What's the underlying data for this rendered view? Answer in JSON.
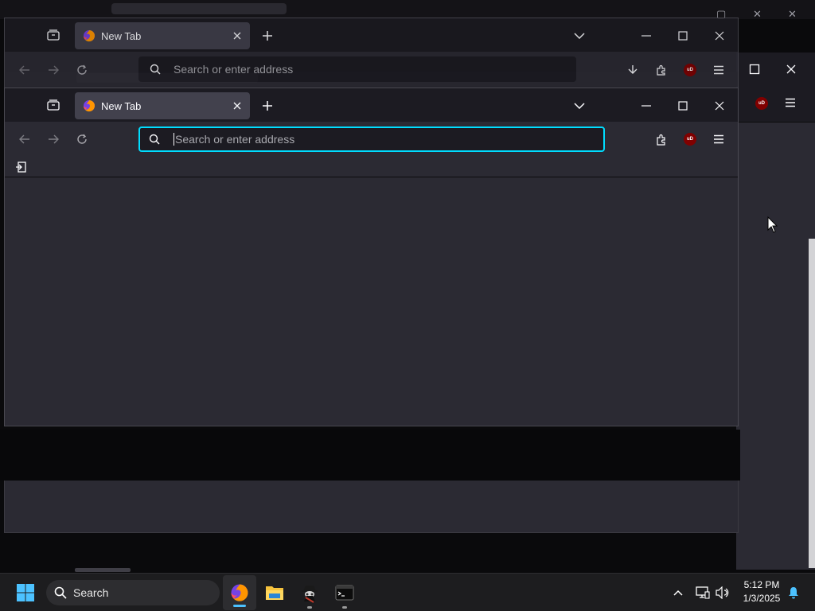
{
  "colors": {
    "accent_focus": "#00ddff",
    "chrome_dark": "#1c1b22",
    "content_bg": "#2b2a33",
    "tab_active": "#42414d",
    "ublock_red": "#800000",
    "taskbar": "#1d1d1f"
  },
  "background_window": {
    "tab": {
      "title": "New Tab",
      "icon": "firefox-icon"
    },
    "url_placeholder": "Search or enter address"
  },
  "front_window": {
    "tab": {
      "title": "New Tab",
      "icon": "firefox-icon",
      "close_icon": "close-icon"
    },
    "tabbar_buttons": [
      "firefox-view-icon",
      "new-tab-icon",
      "list-all-tabs-icon"
    ],
    "window_controls": [
      "minimize-icon",
      "maximize-icon",
      "close-icon"
    ],
    "nav_buttons": [
      "back-icon",
      "forward-icon",
      "reload-icon"
    ],
    "urlbar": {
      "placeholder": "Search or enter address",
      "value": ""
    },
    "toolbar_right": [
      "extensions-icon",
      "ublock-origin-icon",
      "menu-icon"
    ],
    "bookmarks_toolbar": [
      "import-bookmarks-icon"
    ],
    "ublock_label": "uD"
  },
  "taskbar": {
    "start_icon": "windows-start-icon",
    "search_label": "Search",
    "apps": [
      {
        "name": "firefox",
        "icon": "firefox-icon",
        "active": true
      },
      {
        "name": "file-explorer",
        "icon": "folder-icon",
        "active": false
      },
      {
        "name": "spy-app",
        "icon": "spy-icon",
        "active": false
      },
      {
        "name": "terminal",
        "icon": "terminal-icon",
        "active": false
      }
    ],
    "tray_icons": [
      "chevron-up-icon",
      "network-icon",
      "volume-icon",
      "notification-bell-icon"
    ],
    "time": "5:12 PM",
    "date": "1/3/2025"
  }
}
